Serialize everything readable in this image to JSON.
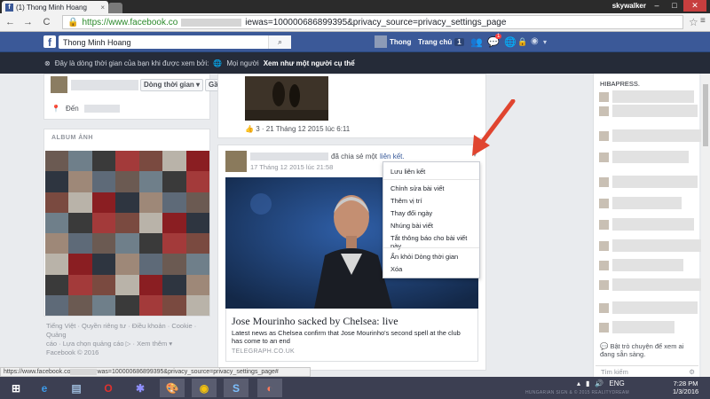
{
  "browser": {
    "tab_title": "(1) Thong Minh Hoang",
    "tab_close": "×",
    "profile_name": "skywalker",
    "window_controls": [
      "–",
      "□",
      "✕"
    ],
    "nav": {
      "back": "←",
      "forward": "→",
      "reload": "C"
    },
    "url_prefix": "https://www.facebook.co",
    "url_suffix": "iewas=100000686899395&privacy_source=privacy_settings_page",
    "star": "☆",
    "menu": "≡"
  },
  "fb_header": {
    "logo": "f",
    "search_value": "Thong Minh Hoang",
    "user_name": "Thong",
    "home_label": "Trang chủ",
    "home_count": "1",
    "messages_badge": "1"
  },
  "notice": {
    "text": "Đây là dòng thời gian của bạn khi được xem bởi:",
    "audience": "Mọi người",
    "link": "Xem như một người cụ thể"
  },
  "left": {
    "timeline_pill": "Dòng thời gian",
    "recent_pill": "Gần đây",
    "place_label": "Đến",
    "album_title": "ALBUM ẢNH",
    "footer_lines": [
      "Tiếng Việt · Quyền riêng tư · Điều khoản · Cookie · Quảng",
      "cáo · Lựa chọn quảng cáo ▷ · Xem thêm ▾",
      "Facebook © 2016"
    ]
  },
  "prev_post": {
    "reactions": "3 · 21 Tháng 12 2015 lúc 6:11"
  },
  "post": {
    "shared_text": "đã chia sẻ một",
    "shared_link": "liên kết.",
    "time": "17 Tháng 12 2015 lúc 21:58",
    "article_title": "Jose Mourinho sacked by Chelsea: live",
    "article_desc": "Latest news as Chelsea confirm that Jose Mourinho's second spell at the club has come to an end",
    "article_source": "TELEGRAPH.CO.UK"
  },
  "dropdown": {
    "items": [
      "Lưu liên kết",
      "Chỉnh sửa bài viết",
      "Thêm vị trí",
      "Thay đổi ngày",
      "Nhúng bài viết",
      "Tắt thông báo cho bài viết này",
      "Ẩn khỏi Dòng thời gian",
      "Xóa"
    ]
  },
  "right": {
    "top_name": "HIBAPRESS.",
    "chat_on": "Bật trò chuyện để xem ai đang sẵn sàng.",
    "chat_search": "Tìm kiếm"
  },
  "statusbar": {
    "prefix": "https://www.facebook.co",
    "suffix": "was=100000686899395&privacy_source=privacy_settings_page#"
  },
  "taskbar": {
    "lang": "ENG",
    "time": "7:28 PM",
    "date": "1/3/2016",
    "watermark": "HUNGARIAN SIGN & © 2015 REALITYDREAM"
  },
  "colors": {
    "fb_blue": "#3b5998",
    "link": "#365899",
    "notice_bg": "#252b38",
    "arrow": "#e0442f"
  }
}
